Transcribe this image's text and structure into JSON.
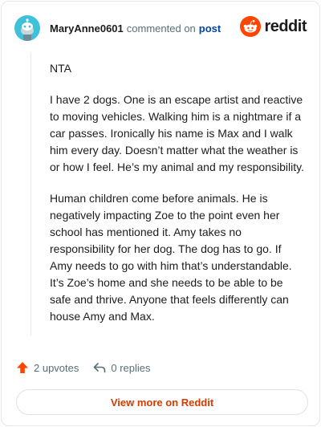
{
  "header": {
    "username": "MaryAnne0601",
    "commented_on": "commented on",
    "post_link": "post",
    "brand_name": "reddit",
    "brand_color": "#ff4500"
  },
  "comment": {
    "paragraphs": [
      "NTA",
      "I have 2 dogs. One is an escape artist and reactive to moving vehicles. Walking him is a nightmare if a car passes. Ironically his name is Max and I walk him every day. Doesn’t matter what the weather is or how I feel. He’s my animal and my responsibility.",
      "Human children come before animals. He is negatively impacting Zoe to the point even her school has mentioned it. Amy takes no responsibility for her dog. The dog has to go. If Amy needs to go with him that’s understandable. It’s Zoe’s home and she needs to be able to be safe and thrive. Anyone that feels differently can house Amy and Max."
    ]
  },
  "actions": {
    "upvotes": "2 upvotes",
    "replies": "0 replies",
    "upvote_icon": "upvote-arrow-icon",
    "reply_icon": "reply-arrow-icon",
    "upvote_color": "#ff4500"
  },
  "view_more_label": "View more on Reddit"
}
